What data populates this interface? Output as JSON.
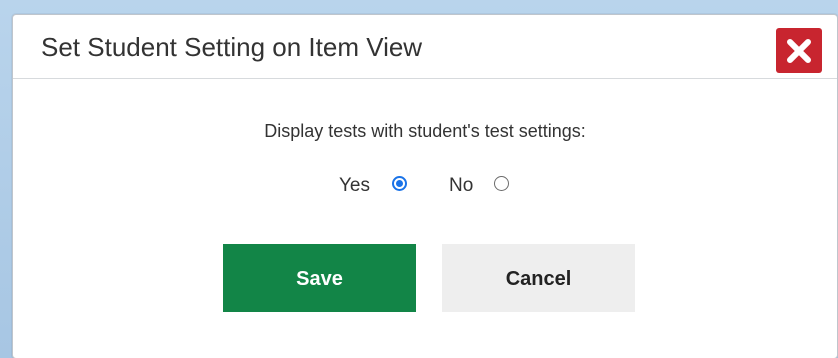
{
  "dialog": {
    "title": "Set Student Setting on Item View",
    "prompt": "Display tests with student's test settings:",
    "options": [
      {
        "label": "Yes",
        "checked": true
      },
      {
        "label": "No",
        "checked": false
      }
    ],
    "save_label": "Save",
    "cancel_label": "Cancel",
    "close_icon": "close-icon"
  },
  "colors": {
    "save_button": "#128547",
    "close_button": "#c8252f",
    "radio_selected": "#1a73e8",
    "cancel_button": "#eeeeee"
  }
}
